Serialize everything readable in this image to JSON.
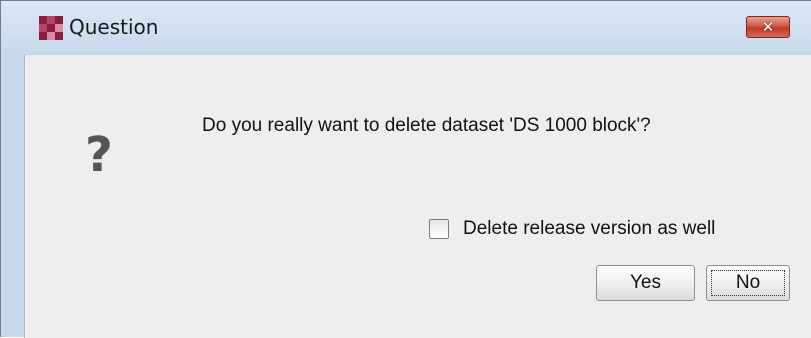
{
  "window": {
    "title": "Question",
    "close_label": "✕",
    "icon": "app-logo-icon"
  },
  "dialog": {
    "message": "Do you really want to delete dataset 'DS 1000 block'?",
    "icon_glyph": "?",
    "icon": "question-icon",
    "checkbox": {
      "label": "Delete release version as well",
      "checked": false
    },
    "buttons": {
      "yes_label": "Yes",
      "no_label": "No"
    }
  },
  "colors": {
    "title_bar": "#c8d8ec",
    "client_bg": "#eeeeee",
    "close_button": "#c0392b",
    "app_icon_primary": "#8b1e3f"
  }
}
